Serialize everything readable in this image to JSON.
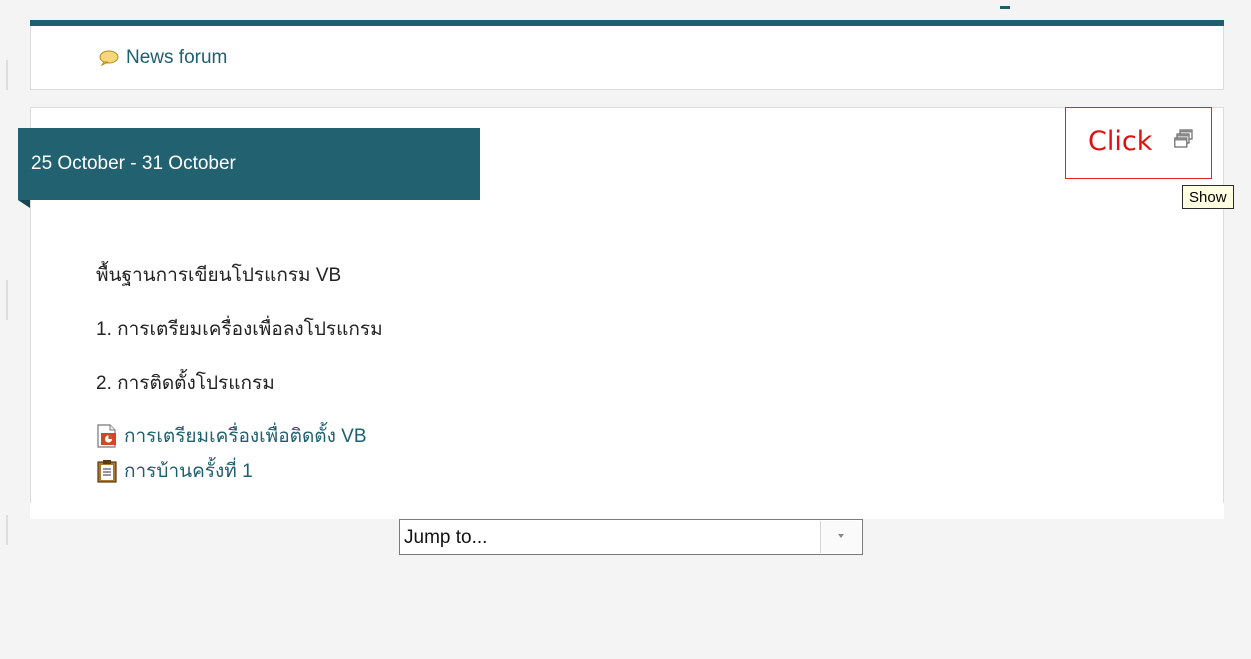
{
  "forum": {
    "label": "News forum",
    "icon": "speech-bubble-icon"
  },
  "section": {
    "title": "25 October - 31 October",
    "summary": [
      "พื้นฐานการเขียนโปรแกรม VB",
      "1. การเตรียมเครื่องเพื่อลงโปรแกรม",
      "2. การติดตั้งโปรแกรม"
    ],
    "resources": [
      {
        "label": "การเตรียมเครื่องเพื่อติดตั้ง VB",
        "icon": "powerpoint-file-icon"
      },
      {
        "label": "การบ้านครั้งที่ 1",
        "icon": "assignment-clipboard-icon"
      }
    ]
  },
  "annotation": {
    "label": "Click",
    "color": "#e01010"
  },
  "tooltip": {
    "text": "Show"
  },
  "jump": {
    "value": "Jump to..."
  },
  "colors": {
    "accent": "#1e5f6e",
    "banner": "#22616f",
    "annotation_border": "#e02424"
  }
}
